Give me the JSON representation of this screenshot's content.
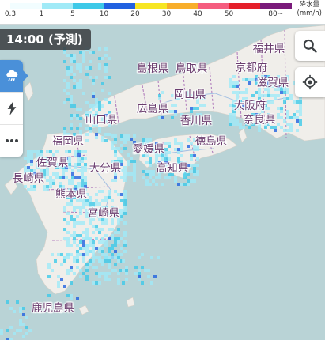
{
  "legend": {
    "unit": "降水量\n(mm/h)",
    "ticks": [
      "0.3",
      "1",
      "5",
      "10",
      "20",
      "30",
      "40",
      "50",
      "80~"
    ],
    "colors": [
      "#f2fdff",
      "#a0eaf7",
      "#3dc9e8",
      "#2161e0",
      "#f7e623",
      "#f8ae2a",
      "#f55d7f",
      "#e51f2a",
      "#7a1a7a"
    ]
  },
  "time_label": "14:00 (予測)",
  "tools": {
    "rain_icon": "rain-cloud-icon",
    "lightning_icon": "lightning-icon",
    "more_icon": "more-dots-icon"
  },
  "controls": {
    "search_icon": "search-icon",
    "locate_icon": "current-location-icon"
  },
  "prefectures": [
    {
      "id": "fukui",
      "name": "福井県"
    },
    {
      "id": "kyoto",
      "name": "京都府"
    },
    {
      "id": "shimane",
      "name": "島根県"
    },
    {
      "id": "tottori",
      "name": "鳥取県"
    },
    {
      "id": "shiga",
      "name": "滋賀県"
    },
    {
      "id": "okayama",
      "name": "岡山県"
    },
    {
      "id": "hiroshima",
      "name": "広島県"
    },
    {
      "id": "osaka",
      "name": "大阪府"
    },
    {
      "id": "yamaguchi",
      "name": "山口県"
    },
    {
      "id": "kagawa",
      "name": "香川県"
    },
    {
      "id": "nara",
      "name": "奈良県"
    },
    {
      "id": "fukuoka",
      "name": "福岡県"
    },
    {
      "id": "tokushima",
      "name": "徳島県"
    },
    {
      "id": "ehime",
      "name": "愛媛県"
    },
    {
      "id": "saga",
      "name": "佐賀県"
    },
    {
      "id": "oita",
      "name": "大分県"
    },
    {
      "id": "kochi",
      "name": "高知県"
    },
    {
      "id": "nagasaki",
      "name": "長崎県"
    },
    {
      "id": "kumamoto",
      "name": "熊本県"
    },
    {
      "id": "miyazaki",
      "name": "宮崎県"
    },
    {
      "id": "kagoshima",
      "name": "鹿児島県"
    }
  ],
  "colors": {
    "sea": "#b9d3d6",
    "land": "#f0eeea",
    "border": "#b27fbd",
    "rain_light": "#a0eaf7",
    "rain_mid": "#3dc9e8",
    "rain_heavy": "#2161e0"
  }
}
